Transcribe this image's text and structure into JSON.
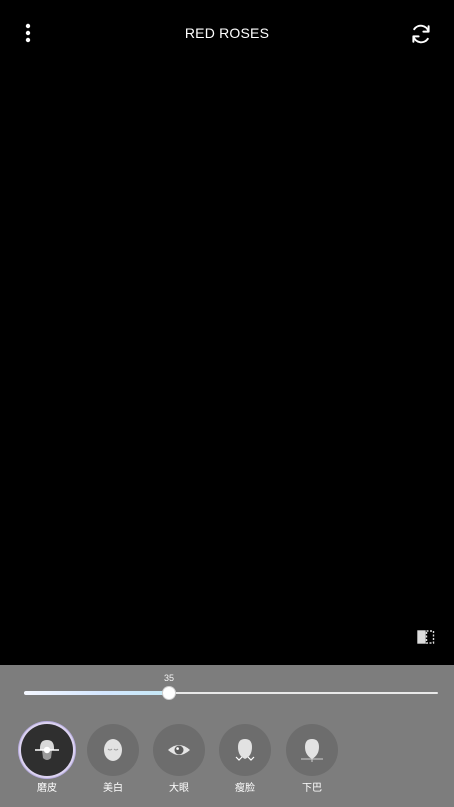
{
  "header": {
    "title": "RED ROSES",
    "menu_icon": "more-vertical-icon",
    "switch_icon": "refresh-icon"
  },
  "compare_icon": "compare-icon",
  "slider": {
    "value_label": "35",
    "value": 35,
    "max": 100
  },
  "effects": [
    {
      "label": "磨皮",
      "icon": "smooth-skin-icon",
      "active": true
    },
    {
      "label": "美白",
      "icon": "whiten-icon",
      "active": false
    },
    {
      "label": "大眼",
      "icon": "eye-icon",
      "active": false
    },
    {
      "label": "瘦脸",
      "icon": "slim-face-icon",
      "active": false
    },
    {
      "label": "下巴",
      "icon": "chin-icon",
      "active": false
    }
  ],
  "colors": {
    "panel": "#7d7d7d",
    "camera_bg": "#000000",
    "active_ring": "#dcd3f0"
  }
}
